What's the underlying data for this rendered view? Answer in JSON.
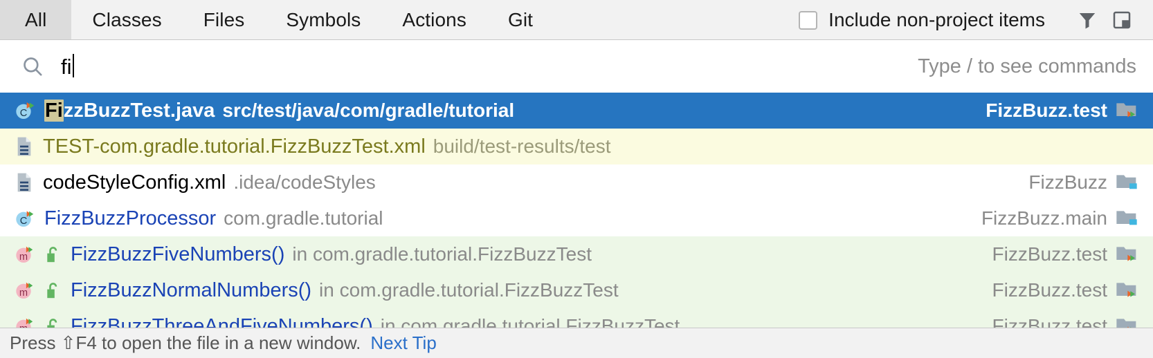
{
  "tabs": [
    {
      "label": "All",
      "active": true
    },
    {
      "label": "Classes",
      "active": false
    },
    {
      "label": "Files",
      "active": false
    },
    {
      "label": "Symbols",
      "active": false
    },
    {
      "label": "Actions",
      "active": false
    },
    {
      "label": "Git",
      "active": false
    }
  ],
  "toolbar": {
    "include_non_project_label": "Include non-project items",
    "include_non_project_checked": false,
    "filter_icon": "filter-funnel-icon",
    "panel_icon": "open-in-panel-icon"
  },
  "search": {
    "icon": "search-icon",
    "value": "fi",
    "hint": "Type / to see commands",
    "placeholder": "Type / to see commands"
  },
  "colors": {
    "selection_blue": "#2675c0",
    "match_highlight": "#cfc89a",
    "test_row_green": "#edf7e7",
    "build_row_yellow": "#fbfbe0",
    "link_blue": "#1a43b5",
    "muted_gray": "#8a8a8a"
  },
  "results": [
    {
      "icon": "java-class-test-icon",
      "name": "FizzBuzzTest.java",
      "match": "Fi",
      "path": "src/test/java/com/gradle/tutorial",
      "module": "FizzBuzz.test",
      "module_icon": "module-test-folder-icon",
      "selected": true,
      "background": "selected"
    },
    {
      "icon": "xml-file-icon",
      "name": "TEST-com.gradle.tutorial.FizzBuzzTest.xml",
      "match": "",
      "path": "build/test-results/test",
      "module": "",
      "module_icon": "",
      "selected": false,
      "background": "yellow"
    },
    {
      "icon": "xml-file-icon",
      "name": "codeStyleConfig.xml",
      "match": "",
      "path": ".idea/codeStyles",
      "module": "FizzBuzz",
      "module_icon": "module-folder-icon",
      "selected": false,
      "background": "white"
    },
    {
      "icon": "java-class-icon",
      "name": "FizzBuzzProcessor",
      "match": "",
      "path": "com.gradle.tutorial",
      "module": "FizzBuzz.main",
      "module_icon": "module-folder-icon",
      "selected": false,
      "background": "white"
    },
    {
      "icon": "method-test-icon",
      "visibility_icon": "public-unlock-icon",
      "name": "FizzBuzzFiveNumbers()",
      "match": "",
      "path": "in com.gradle.tutorial.FizzBuzzTest",
      "module": "FizzBuzz.test",
      "module_icon": "module-test-folder-icon",
      "selected": false,
      "background": "green"
    },
    {
      "icon": "method-test-icon",
      "visibility_icon": "public-unlock-icon",
      "name": "FizzBuzzNormalNumbers()",
      "match": "",
      "path": "in com.gradle.tutorial.FizzBuzzTest",
      "module": "FizzBuzz.test",
      "module_icon": "module-test-folder-icon",
      "selected": false,
      "background": "green"
    },
    {
      "icon": "method-test-icon",
      "visibility_icon": "public-unlock-icon",
      "name": "FizzBuzzThreeAndFiveNumbers()",
      "match": "",
      "path": "in com.gradle.tutorial.FizzBuzzTest",
      "module": "FizzBuzz.test",
      "module_icon": "module-test-folder-icon",
      "selected": false,
      "background": "green"
    }
  ],
  "status": {
    "text": "Press ⇧F4 to open the file in a new window.",
    "link": "Next Tip"
  }
}
